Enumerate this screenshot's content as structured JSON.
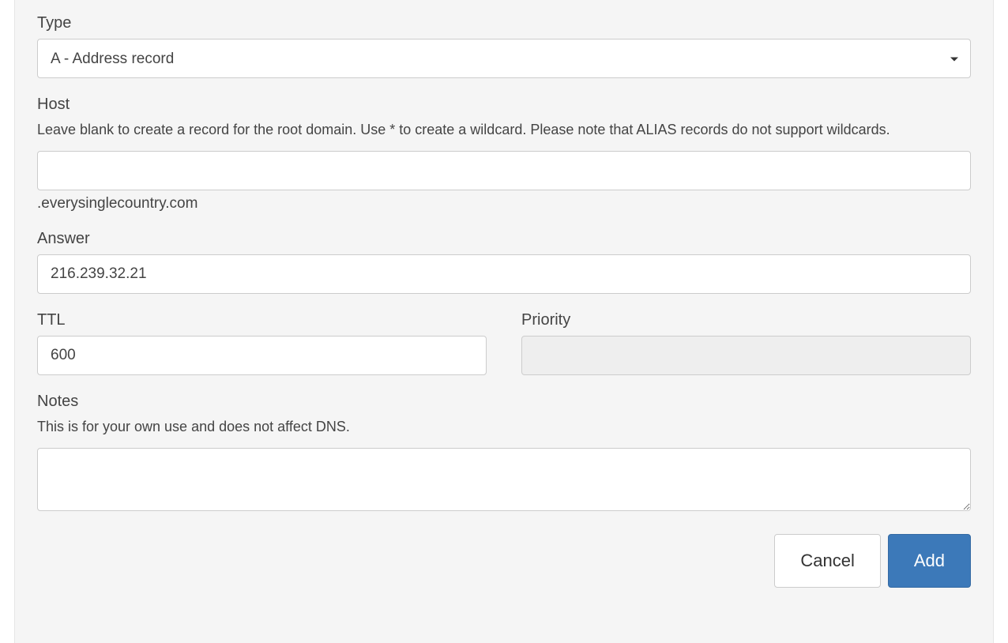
{
  "type": {
    "label": "Type",
    "value": "A - Address record"
  },
  "host": {
    "label": "Host",
    "help": "Leave blank to create a record for the root domain. Use * to create a wildcard. Please note that ALIAS records do not support wildcards.",
    "value": "",
    "suffix": ".everysinglecountry.com"
  },
  "answer": {
    "label": "Answer",
    "value": "216.239.32.21"
  },
  "ttl": {
    "label": "TTL",
    "value": "600"
  },
  "priority": {
    "label": "Priority",
    "value": ""
  },
  "notes": {
    "label": "Notes",
    "help": "This is for your own use and does not affect DNS.",
    "value": ""
  },
  "buttons": {
    "cancel": "Cancel",
    "add": "Add"
  }
}
